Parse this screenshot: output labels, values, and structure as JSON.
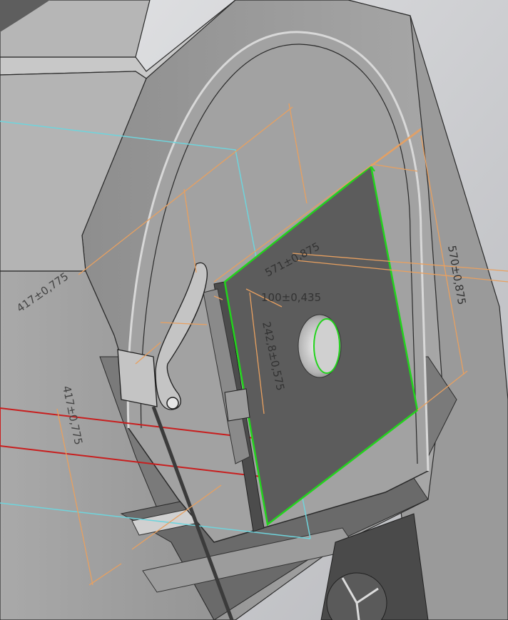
{
  "colors": {
    "dimension": "#e8a060",
    "selection_edge": "#22d41c",
    "construction_line": "#6fd4dc",
    "highlight_outline": "#c81e1e",
    "body_dark": "#616161",
    "body_light": "#b3b3b3",
    "background": "#c4c6c9"
  },
  "dimensions": {
    "d417_upper": "417±0,775",
    "d571_width": "571±0,875",
    "d570_height": "570±0,875",
    "d100": "100±0,435",
    "d242": "242,8±0,575",
    "d417_lower": "417±0,775"
  }
}
